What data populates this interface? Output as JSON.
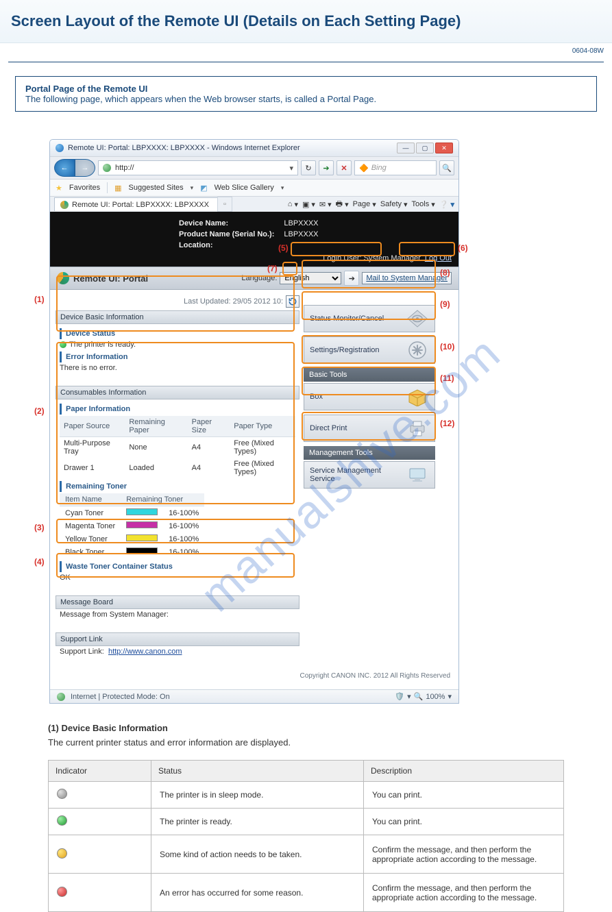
{
  "page": {
    "title": "Screen Layout of the Remote UI (Details on Each Setting Page)",
    "id": "0604-08W",
    "info_label": "Portal Page of the Remote UI",
    "info_desc": "The following page, which appears when the Web browser starts, is called a Portal Page."
  },
  "win": {
    "title": "Remote UI: Portal: LBPXXXX: LBPXXXX - Windows Internet Explorer",
    "url": "http://",
    "search_placeholder": "Bing",
    "fav": "Favorites",
    "suggested": "Suggested Sites",
    "slice": "Web Slice Gallery",
    "tab": "Remote UI: Portal: LBPXXXX: LBPXXXX",
    "menu_page": "Page",
    "menu_safety": "Safety",
    "menu_tools": "Tools",
    "status": "Internet | Protected Mode: On",
    "zoom": "100%"
  },
  "hdr": {
    "dev_lbl": "Device Name:",
    "dev": "LBPXXXX",
    "prod_lbl": "Product Name (Serial No.):",
    "prod": "LBPXXXX",
    "loc_lbl": "Location:",
    "login": "Login User: System Manager",
    "logout": "Log Out"
  },
  "portal": {
    "title": "Remote UI: Portal",
    "lang_lbl": "Language:",
    "lang_sel": "English",
    "mail": "Mail to System Manager"
  },
  "left": {
    "updated": "Last Updated: 29/05 2012 10:",
    "dev_basic": "Device Basic Information",
    "dev_status": "Device Status",
    "ready": "The printer is ready.",
    "err_info": "Error Information",
    "no_err": "There is no error.",
    "cons": "Consumables Information",
    "paper_info": "Paper Information",
    "paper_cols": {
      "c1": "Paper Source",
      "c2": "Remaining Paper",
      "c3": "Paper Size",
      "c4": "Paper Type"
    },
    "paper_rows": [
      {
        "src": "Multi-Purpose Tray",
        "rem": "None",
        "size": "A4",
        "type": "Free (Mixed Types)"
      },
      {
        "src": "Drawer 1",
        "rem": "Loaded",
        "size": "A4",
        "type": "Free (Mixed Types)"
      }
    ],
    "rem_toner": "Remaining Toner",
    "toner_cols": {
      "c1": "Item Name",
      "c2": "Remaining Toner"
    },
    "toner_rows": [
      {
        "name": "Cyan Toner",
        "cls": "cy",
        "val": "16-100%"
      },
      {
        "name": "Magenta Toner",
        "cls": "mg",
        "val": "16-100%"
      },
      {
        "name": "Yellow Toner",
        "cls": "yl",
        "val": "16-100%"
      },
      {
        "name": "Black Toner",
        "cls": "bk",
        "val": "16-100%"
      }
    ],
    "waste": "Waste Toner Container Status",
    "waste_val": "OK",
    "msgb": "Message Board",
    "msg_from": "Message from System Manager:",
    "supl": "Support Link",
    "sup_lbl": "Support Link:",
    "sup_url": "http://www.canon.com"
  },
  "right": {
    "status_mon": "Status Monitor/Cancel",
    "settings": "Settings/Registration",
    "basic": "Basic Tools",
    "box": "Box",
    "direct": "Direct Print",
    "mgmt": "Management Tools",
    "sms": "Service Management Service"
  },
  "copyright": "Copyright CANON INC. 2012 All Rights Reserved",
  "callouts": {
    "n1": "(1)",
    "n2": "(2)",
    "n3": "(3)",
    "n4": "(4)",
    "n5": "(5)",
    "n6": "(6)",
    "n7": "(7)",
    "n8": "(8)",
    "n9": "(9)",
    "n10": "(10)",
    "n11": "(11)",
    "n12": "(12)"
  },
  "desc": {
    "title": "(1) Device Basic Information",
    "p1": "The current printer status and error information are displayed.",
    "tbl": {
      "h1": "Indicator",
      "h2": "Status",
      "h3": "Description",
      "rows": [
        {
          "st": "The printer is in sleep mode.",
          "de": "You can print."
        },
        {
          "st": "The printer is ready.",
          "de": "You can print."
        },
        {
          "st": "Some kind of action needs to be taken.",
          "de": "Confirm the message, and then perform the appropriate action according to the message."
        },
        {
          "st": "An error has occurred for some reason.",
          "de": "Confirm the message, and then perform the appropriate action according to the message."
        }
      ]
    }
  },
  "watermark": "manualshive.com"
}
